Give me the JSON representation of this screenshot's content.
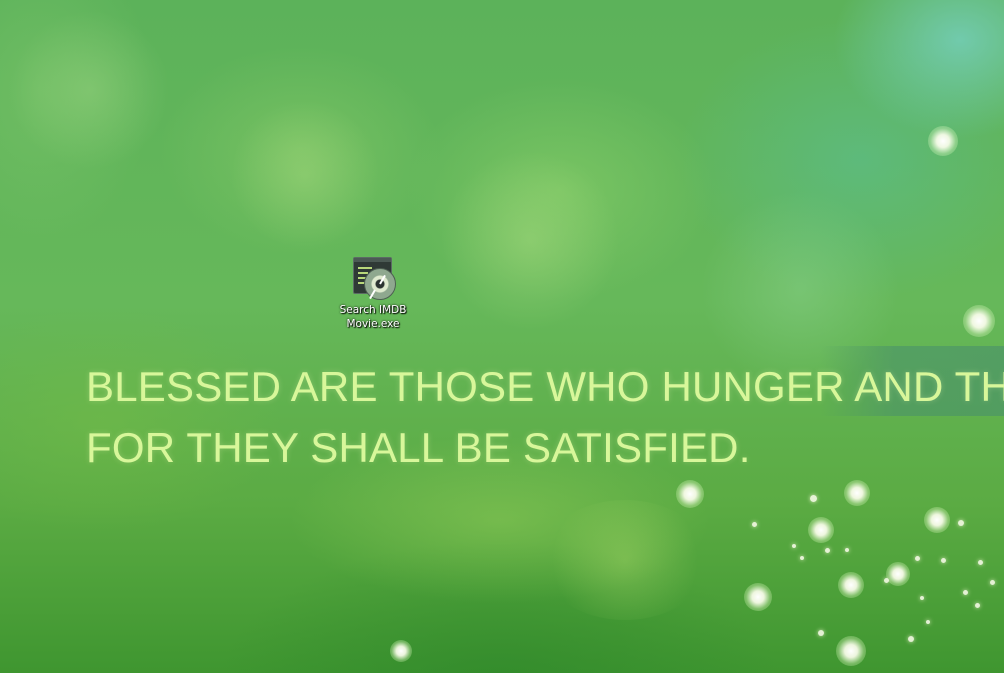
{
  "desktop": {
    "icons": [
      {
        "label_line1": "Search IMDB",
        "label_line2": "Movie.exe",
        "icon": "application-disc-icon"
      }
    ]
  },
  "wallpaper": {
    "verse_line1": "BLESSED ARE THOSE WHO HUNGER AND TH",
    "verse_line2": "FOR THEY SHALL BE SATISFIED.",
    "text_color": "#d8f79a",
    "background_color": "#5cb25a"
  }
}
